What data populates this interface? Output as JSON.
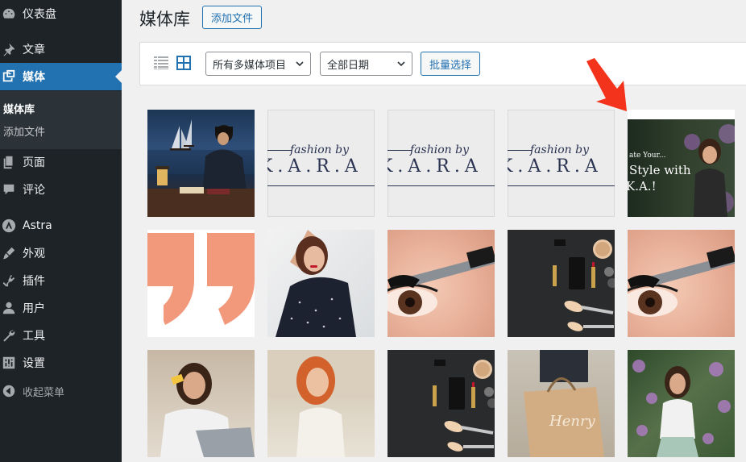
{
  "sidebar": {
    "items": [
      {
        "label": "仪表盘",
        "icon": "dashboard-icon"
      },
      {
        "label": "文章",
        "icon": "pin-icon"
      },
      {
        "label": "媒体",
        "icon": "media-icon",
        "active": true
      },
      {
        "label": "页面",
        "icon": "pages-icon"
      },
      {
        "label": "评论",
        "icon": "comment-icon"
      },
      {
        "label": "Astra",
        "icon": "astra-icon"
      },
      {
        "label": "外观",
        "icon": "brush-icon"
      },
      {
        "label": "插件",
        "icon": "plugin-icon"
      },
      {
        "label": "用户",
        "icon": "user-icon"
      },
      {
        "label": "工具",
        "icon": "wrench-icon"
      },
      {
        "label": "设置",
        "icon": "settings-icon"
      },
      {
        "label": "收起菜单",
        "icon": "collapse-icon"
      }
    ],
    "submenu": [
      {
        "label": "媒体库",
        "current": true
      },
      {
        "label": "添加文件"
      }
    ]
  },
  "header": {
    "title": "媒体库",
    "add_button": "添加文件"
  },
  "toolbar": {
    "filter_type": "所有多媒体项目",
    "filter_date": "全部日期",
    "bulk_select": "批量选择"
  },
  "tiles": {
    "fashion_script": "fashion by",
    "fashion_big": "K.A.R.A",
    "web_line1": "ate Your...",
    "web_line2": "Style with",
    "web_line3": "K.A.!",
    "bag_text": "Henry"
  },
  "colors": {
    "sidebar_bg": "#1d2327",
    "accent": "#2271b1",
    "annotation_arrow": "#f4331c"
  }
}
